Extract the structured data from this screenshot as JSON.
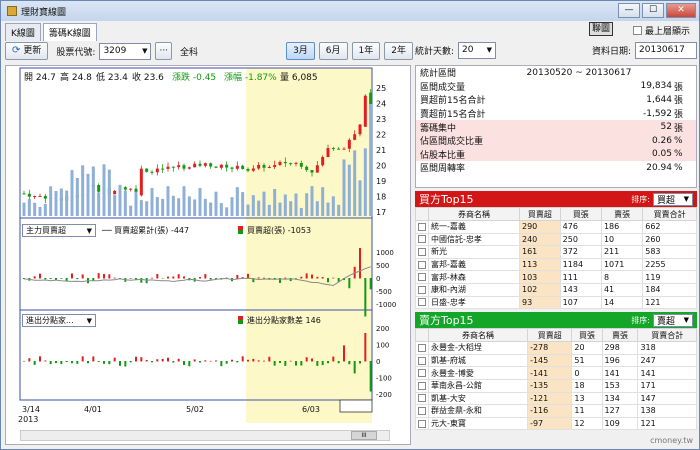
{
  "window": {
    "title": "理財寶線圖",
    "minimize": "—",
    "maximize": "☐",
    "close": "✕"
  },
  "tabs": [
    "K線圖",
    "籌碼K線圖"
  ],
  "top_right": {
    "link_label": "聯圖",
    "checkbox_label": "最上層顯示"
  },
  "toolbar": {
    "refresh_label": "更新",
    "code_label": "股票代號:",
    "code_value": "3209",
    "stock_name": "全科",
    "ranges": [
      "3月",
      "6月",
      "1年",
      "2年"
    ],
    "active_range": "3月"
  },
  "quote": {
    "open_label": "開",
    "open": "24.7",
    "high_label": "高",
    "high": "24.8",
    "low_label": "低",
    "low": "23.4",
    "close_label": "收",
    "close": "23.6",
    "change_label": "漲跌",
    "change": "-0.45",
    "pct_label": "漲幅",
    "pct": "-1.87%",
    "vol_label": "量",
    "vol": "6,085"
  },
  "indicator1": {
    "select": "主力買賣超",
    "line_label": "── 買賣超累計(張) -447",
    "bar_label": "買賣超(張) -1053"
  },
  "indicator2": {
    "select": "進出分點家...",
    "bar_label": "進出分點家數差 146"
  },
  "x_axis": {
    "year": "2013",
    "labels": [
      "3/14",
      "4/01",
      "5/02",
      "6/03"
    ]
  },
  "scroll_thumb": "III",
  "stats_toolbar": {
    "days_label": "統計天數:",
    "days_value": "20",
    "date_label": "資料日期:",
    "date_value": "20130617"
  },
  "stats": [
    {
      "k": "統計區間",
      "v": "20130520 ~ 20130617",
      "u": "",
      "style": "center"
    },
    {
      "k": "區間成交量",
      "v": "19,834",
      "u": "張",
      "style": ""
    },
    {
      "k": "買超前15名合計",
      "v": "1,644",
      "u": "張",
      "style": ""
    },
    {
      "k": "賣超前15名合計",
      "v": "-1,592",
      "u": "張",
      "style": ""
    },
    {
      "k": "籌碼集中",
      "v": "52",
      "u": "張",
      "style": "pink"
    },
    {
      "k": "佔區間成交比重",
      "v": "0.26",
      "u": "%",
      "style": "pink"
    },
    {
      "k": "佔股本比重",
      "v": "0.05",
      "u": "%",
      "style": "pink"
    },
    {
      "k": "區間周轉率",
      "v": "20.94",
      "u": "%",
      "style": ""
    }
  ],
  "buy_top": {
    "title": "買方Top15",
    "sort_label": "排序:",
    "sort_value": "買超",
    "headers": [
      "券商名稱",
      "買賣超",
      "買張",
      "賣張",
      "買賣合計"
    ],
    "rows": [
      [
        "統一-嘉義",
        "290",
        "476",
        "186",
        "662"
      ],
      [
        "中國信託-忠孝",
        "240",
        "250",
        "10",
        "260"
      ],
      [
        "新光",
        "161",
        "372",
        "211",
        "583"
      ],
      [
        "富邦-嘉義",
        "113",
        "1184",
        "1071",
        "2255"
      ],
      [
        "富邦-林森",
        "103",
        "111",
        "8",
        "119"
      ],
      [
        "康和-內湖",
        "102",
        "143",
        "41",
        "184"
      ],
      [
        "日盛-忠孝",
        "93",
        "107",
        "14",
        "121"
      ]
    ]
  },
  "sell_top": {
    "title": "賣方Top15",
    "sort_label": "排序:",
    "sort_value": "賣超",
    "headers": [
      "券商名稱",
      "買賣超",
      "買張",
      "賣張",
      "買賣合計"
    ],
    "rows": [
      [
        "永豐金-大稻埕",
        "-278",
        "20",
        "298",
        "318"
      ],
      [
        "凱基-府城",
        "-145",
        "51",
        "196",
        "247"
      ],
      [
        "永豐金-博愛",
        "-141",
        "0",
        "141",
        "141"
      ],
      [
        "華南永昌-公館",
        "-135",
        "18",
        "153",
        "171"
      ],
      [
        "凱基-大安",
        "-121",
        "13",
        "134",
        "147"
      ],
      [
        "群益金鼎-永和",
        "-116",
        "11",
        "127",
        "138"
      ],
      [
        "元大-東寶",
        "-97",
        "12",
        "109",
        "121"
      ]
    ]
  },
  "watermark": "cmoney.tw",
  "colors": {
    "up": "#e02020",
    "down": "#129a12",
    "volume": "#8fb0d6",
    "highlight": "#fdf8c8",
    "avg": "#8a8a8a"
  },
  "y_axes": {
    "price": [
      "25",
      "24",
      "23",
      "22",
      "21",
      "20",
      "19",
      "18",
      "17"
    ],
    "ind1": [
      "1000",
      "500",
      "0",
      "-500",
      "-1000"
    ],
    "ind2": [
      "200",
      "100",
      "0",
      "-100",
      "-200"
    ]
  }
}
